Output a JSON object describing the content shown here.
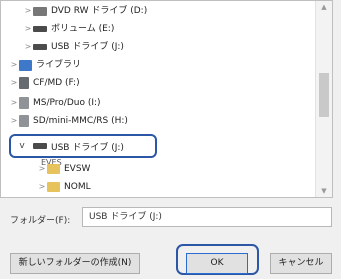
{
  "tree": {
    "items": [
      {
        "label": "DVD RW ドライブ (D:)",
        "icon": "dvd-drive-icon"
      },
      {
        "label": "ボリューム (E:)",
        "icon": "drive-icon"
      },
      {
        "label": "USB ドライブ (J:)",
        "icon": "usb-drive-icon"
      },
      {
        "label": "ライブラリ",
        "icon": "library-icon"
      },
      {
        "label": "CF/MD (F:)",
        "icon": "card-drive-icon"
      },
      {
        "label": "MS/Pro/Duo (I:)",
        "icon": "card-drive-icon"
      },
      {
        "label": "SD/mini-MMC/RS (H:)",
        "icon": "card-drive-icon"
      },
      {
        "label": "EVSW",
        "icon": "folder-icon"
      },
      {
        "label": "NOML",
        "icon": "folder-icon"
      }
    ],
    "selected_label": "USB ドライブ (J:)",
    "clipped_text": "EVES"
  },
  "folder_field": {
    "label": "フォルダー(F):",
    "value": "USB ドライブ (J:)"
  },
  "buttons": {
    "new_folder": "新しいフォルダーの作成(N)",
    "ok": "OK",
    "cancel": "キャンセル"
  },
  "colors": {
    "highlight": "#2c56a6",
    "folder": "#e6c35c",
    "library": "#3e78c9"
  }
}
